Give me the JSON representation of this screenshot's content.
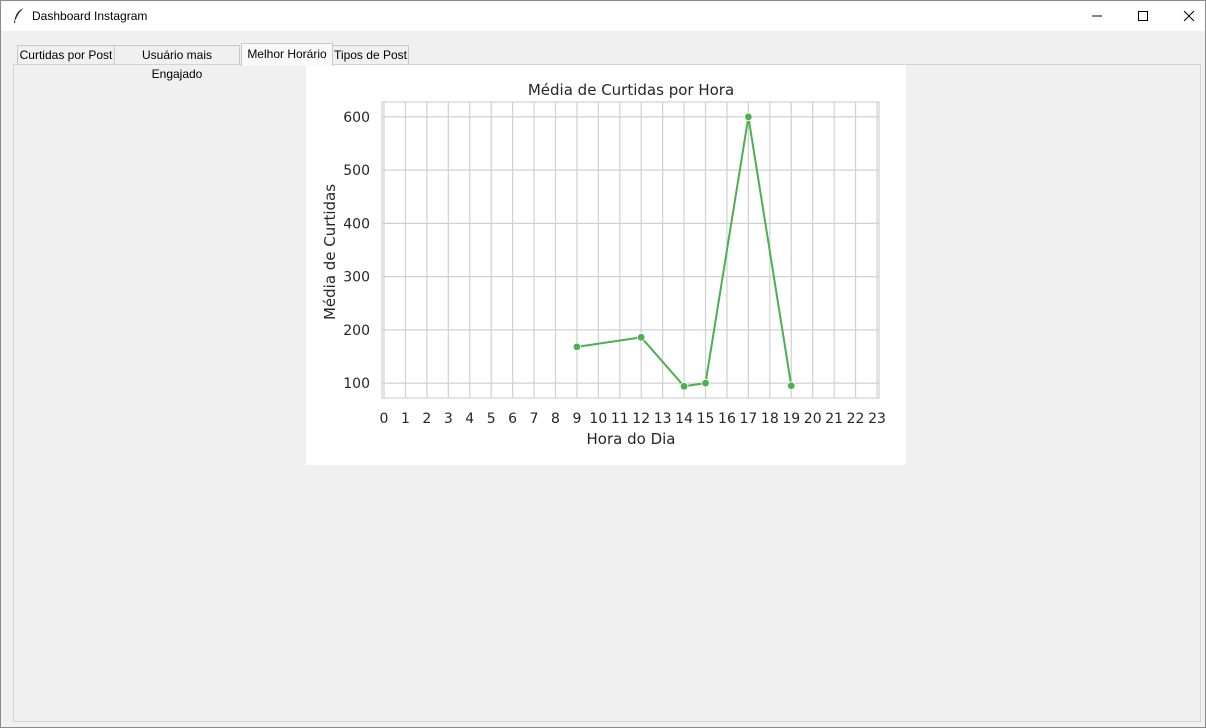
{
  "window": {
    "title": "Dashboard Instagram",
    "icon": "feather-icon",
    "controls": [
      "minimize-icon",
      "maximize-icon",
      "close-icon"
    ]
  },
  "tabs": [
    {
      "label": "Curtidas por Post"
    },
    {
      "label": "Usuário mais Engajado"
    },
    {
      "label": "Melhor Horário"
    },
    {
      "label": "Tipos de Post"
    }
  ],
  "active_tab": "Melhor Horário",
  "colors": {
    "line": "#4caf50",
    "grid": "#d0d0d0",
    "axis_text": "#262626"
  },
  "chart_data": {
    "type": "line",
    "title": "Média de Curtidas por Hora",
    "xlabel": "Hora do Dia",
    "ylabel": "Média de Curtidas",
    "xlim": [
      0,
      23
    ],
    "ylim": [
      72,
      628
    ],
    "xticks": [
      0,
      1,
      2,
      3,
      4,
      5,
      6,
      7,
      8,
      9,
      10,
      11,
      12,
      13,
      14,
      15,
      16,
      17,
      18,
      19,
      20,
      21,
      22,
      23
    ],
    "yticks": [
      100,
      200,
      300,
      400,
      500,
      600
    ],
    "grid": true,
    "series": [
      {
        "x": [
          9,
          12,
          14,
          15,
          17,
          19
        ],
        "y": [
          168,
          186,
          94,
          100,
          600,
          95
        ]
      }
    ]
  }
}
